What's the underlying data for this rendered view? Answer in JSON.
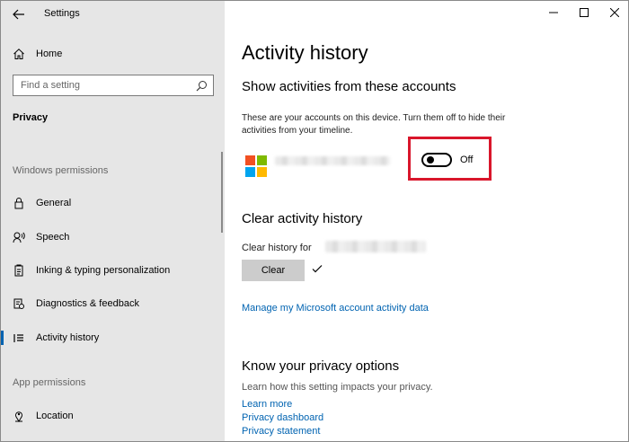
{
  "window": {
    "title": "Settings"
  },
  "sidebar": {
    "home_label": "Home",
    "search_placeholder": "Find a setting",
    "section_title": "Privacy",
    "windows_permissions_label": "Windows permissions",
    "items": [
      {
        "label": "General",
        "icon": "lock-icon"
      },
      {
        "label": "Speech",
        "icon": "speech-icon"
      },
      {
        "label": "Inking & typing personalization",
        "icon": "clipboard-icon"
      },
      {
        "label": "Diagnostics & feedback",
        "icon": "diagnostics-icon"
      },
      {
        "label": "Activity history",
        "icon": "activity-history-icon",
        "active": true
      }
    ],
    "app_permissions_label": "App permissions",
    "app_items": [
      {
        "label": "Location",
        "icon": "location-icon"
      }
    ]
  },
  "main": {
    "title": "Activity history",
    "show_activities": {
      "heading": "Show activities from these accounts",
      "description_line1": "These are your accounts on this device. Turn them off to hide their",
      "description_line2": "activities from your timeline.",
      "toggle_state": "Off"
    },
    "clear_history": {
      "heading": "Clear activity history",
      "label": "Clear history for",
      "button_label": "Clear"
    },
    "manage_link": "Manage my Microsoft account activity data",
    "privacy_options": {
      "heading": "Know your privacy options",
      "description": "Learn how this setting impacts your privacy.",
      "links": [
        "Learn more",
        "Privacy dashboard",
        "Privacy statement"
      ]
    }
  },
  "colors": {
    "sidebar_bg": "#e6e6e6",
    "accent": "#0063b1",
    "highlight": "#d9162b"
  }
}
